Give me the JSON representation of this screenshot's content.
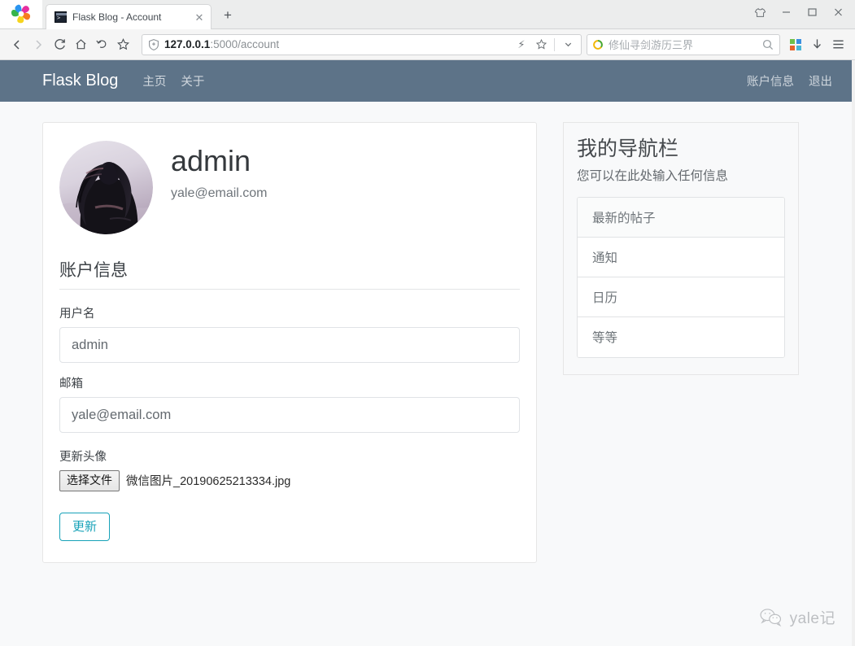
{
  "browser": {
    "logo_icon": "360-pinwheel-logo",
    "tab": {
      "favicon": "terminal-favicon",
      "title": "Flask Blog - Account",
      "close_icon": "close-icon"
    },
    "newtab_label": "+",
    "window_controls": {
      "skin": "tshirt-icon",
      "minimize": "minimize-icon",
      "maximize": "maximize-icon",
      "close": "close-icon"
    },
    "toolbar": {
      "back_icon": "chevron-left-icon",
      "forward_icon": "chevron-right-icon",
      "reload_icon": "reload-icon",
      "home_icon": "home-icon",
      "undo_icon": "undo-arrow-icon",
      "bookmark_icon": "star-icon",
      "shield_icon": "shield-icon",
      "url_host": "127.0.0.1",
      "url_path": ":5000/account",
      "lightning_icon": "lightning-icon",
      "star_icon": "star-outline-icon",
      "chevron_down_icon": "chevron-down-icon",
      "apps_icon": "apps-grid-icon",
      "download_icon": "download-arrow-icon",
      "menu_icon": "hamburger-menu-icon"
    },
    "search": {
      "logo_icon": "360-search-logo",
      "placeholder": "修仙寻剑游历三界",
      "magnifier_icon": "search-icon"
    }
  },
  "site": {
    "brand": "Flask Blog",
    "nav_left": [
      {
        "label": "主页"
      },
      {
        "label": "关于"
      }
    ],
    "nav_right": [
      {
        "label": "账户信息"
      },
      {
        "label": "退出"
      }
    ],
    "colors": {
      "navbar_bg": "#5d7388",
      "page_bg": "#f8f9fa",
      "accent_info": "#17a2b8"
    }
  },
  "account": {
    "avatar_alt": "user-avatar",
    "username_heading": "admin",
    "email_display": "yale@email.com",
    "legend": "账户信息",
    "fields": [
      {
        "label": "用户名",
        "value": "admin",
        "placeholder": "admin",
        "name": "username-input"
      },
      {
        "label": "邮箱",
        "value": "yale@email.com",
        "placeholder": "yale@email.com",
        "name": "email-input"
      }
    ],
    "file_label": "更新头像",
    "file_button": "选择文件",
    "file_name": "微信图片_20190625213334.jpg",
    "submit_label": "更新"
  },
  "sidebar": {
    "title": "我的导航栏",
    "subtitle": "您可以在此处输入任何信息",
    "items": [
      {
        "label": "最新的帖子"
      },
      {
        "label": "通知"
      },
      {
        "label": "日历"
      },
      {
        "label": "等等"
      }
    ]
  },
  "watermark": {
    "icon": "wechat-icon",
    "text": "yale记"
  }
}
